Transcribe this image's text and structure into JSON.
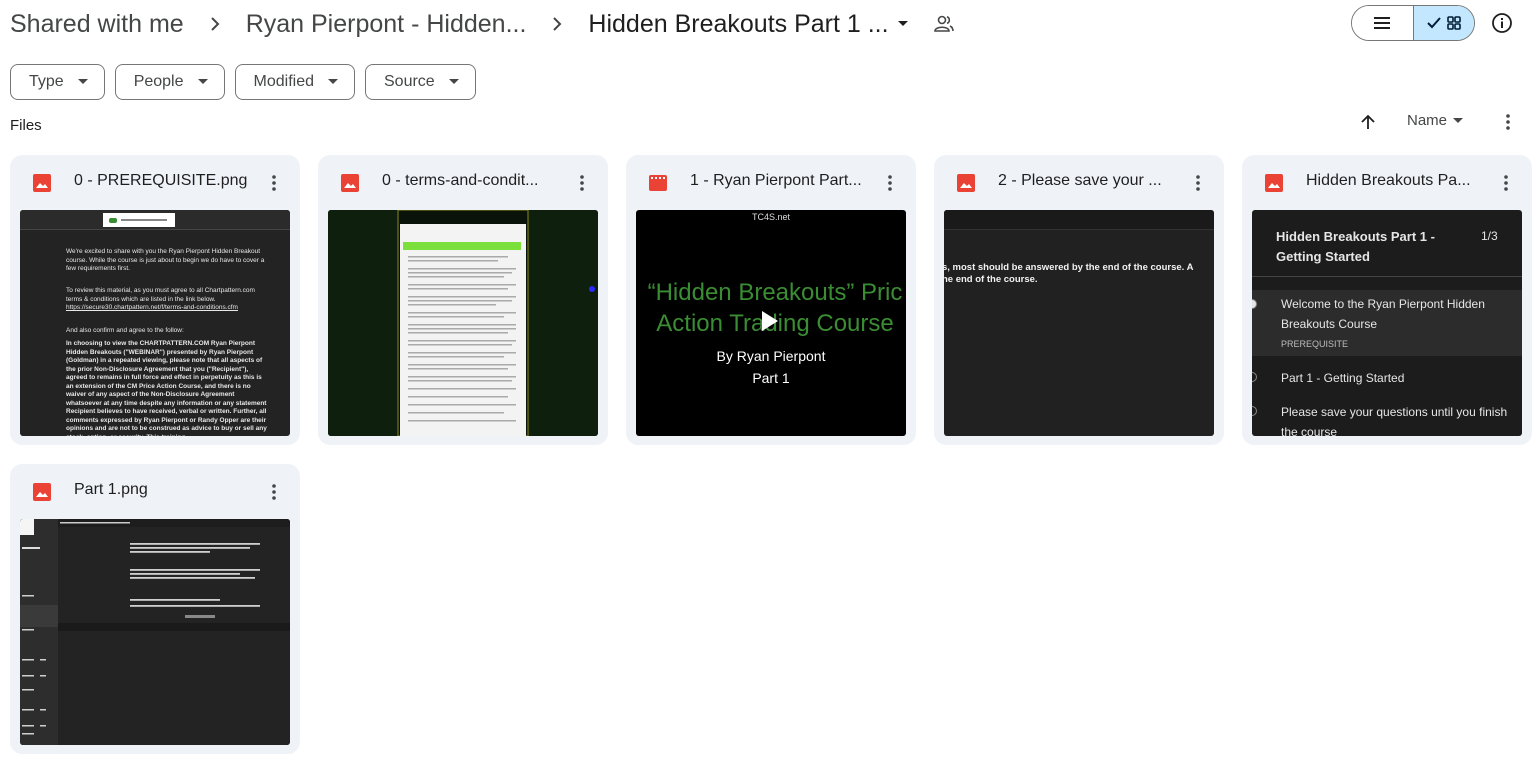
{
  "breadcrumb": {
    "root": "Shared with me",
    "parent": "Ryan Pierpont - Hidden...",
    "current": "Hidden Breakouts Part 1 ..."
  },
  "filters": [
    {
      "label": "Type"
    },
    {
      "label": "People"
    },
    {
      "label": "Modified"
    },
    {
      "label": "Source"
    }
  ],
  "section_label": "Files",
  "sort": {
    "label": "Name"
  },
  "files": [
    {
      "name": "0 - PREREQUISITE.png",
      "type": "image",
      "icon": "image-icon",
      "icon_color": "#ea4335"
    },
    {
      "name": "0 - terms-and-condit...",
      "type": "image",
      "icon": "image-icon",
      "icon_color": "#ea4335"
    },
    {
      "name": "1 - Ryan Pierpont Part...",
      "type": "video",
      "icon": "video-icon",
      "icon_color": "#ea4335"
    },
    {
      "name": "2 - Please save your ...",
      "type": "image",
      "icon": "image-icon",
      "icon_color": "#ea4335"
    },
    {
      "name": "Hidden Breakouts Pa...",
      "type": "image",
      "icon": "image-icon",
      "icon_color": "#ea4335"
    },
    {
      "name": "Part 1.png",
      "type": "image",
      "icon": "image-icon",
      "icon_color": "#ea4335"
    }
  ],
  "thumbs": {
    "video": {
      "watermark": "TC4S.net",
      "title_line1": "“Hidden Breakouts” Pric",
      "title_line2": "Action Trading Course",
      "subtitle": "By Ryan Pierpont",
      "part": "Part 1"
    },
    "questions": {
      "line1": "s, most should be answered by the end of the course.  A",
      "line2": "he end of the course."
    },
    "menu": {
      "title": "Hidden Breakouts Part 1 - Getting Started",
      "count": "1/3",
      "item1": "Welcome to the Ryan Pierpont Hidden Breakouts Course",
      "item1_tag": "PREREQUISITE",
      "item2": "Part 1 - Getting Started",
      "item3": "Please save your questions until you finish the course"
    },
    "prereq": {
      "p1": "We're excited to share with you the Ryan Pierpont Hidden Breakout course. While the course is just about to begin we do have to cover a few requirements first.",
      "p2": "To review this material, as you must agree to all Chartpattern.com terms & conditions which are listed in the link below.",
      "p2_link": "https://secure30.chartpattern.net/f/terms-and-conditions.cfm",
      "p3": "And also confirm and agree to the follow:",
      "p4": "In choosing to view the CHARTPATTERN.COM Ryan Pierpont Hidden Breakouts (\"WEBINAR\") presented by Ryan Pierpont (Goldman) in a repeated viewing, please note that all aspects of the prior Non-Disclosure Agreement that you (\"Recipient\"), agreed to remains in full force and effect in perpetuity as this is an extension of the CM Price Action Course, and there is no waiver of any aspect of the Non-Disclosure Agreement whatsoever at any time despite any information or any statement Recipient believes to have received, verbal or written. Further, all comments expressed by Ryan Pierpont or Randy Opper are their opinions and are not to be construed as advice to buy or sell any stock, option, or security. This training"
    }
  }
}
